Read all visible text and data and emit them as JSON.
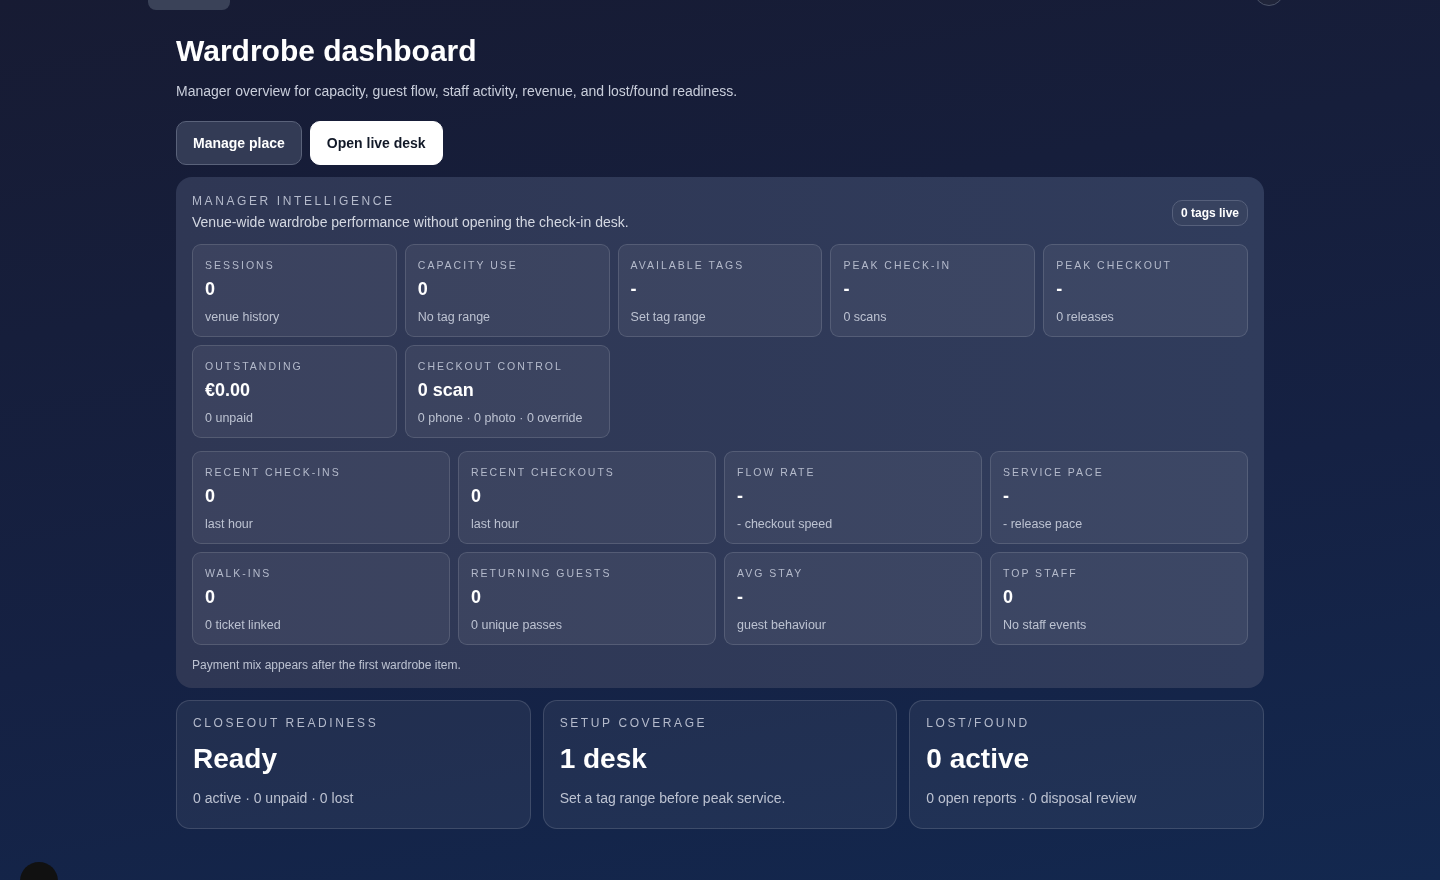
{
  "title": "Wardrobe dashboard",
  "subtitle": "Manager overview for capacity, guest flow, staff activity, revenue, and lost/found readiness.",
  "actions": [
    {
      "label": "Manage place",
      "kind": "secondary"
    },
    {
      "label": "Open live desk",
      "kind": "primary"
    }
  ],
  "intelligence": {
    "heading": "MANAGER INTELLIGENCE",
    "description": "Venue-wide wardrobe performance without opening the check-in desk.",
    "badge": "0 tags live",
    "groups": [
      {
        "kind": "compact",
        "cards": [
          {
            "label": "SESSIONS",
            "value": "0",
            "detail": "venue history"
          },
          {
            "label": "CAPACITY USE",
            "value": "0",
            "detail": "No tag range"
          },
          {
            "label": "AVAILABLE TAGS",
            "value": "-",
            "detail": "Set tag range"
          },
          {
            "label": "PEAK CHECK-IN",
            "value": "-",
            "detail": "0 scans"
          },
          {
            "label": "PEAK CHECKOUT",
            "value": "-",
            "detail": "0 releases"
          },
          {
            "label": "OUTSTANDING",
            "value": "€0.00",
            "detail": "0 unpaid"
          },
          {
            "label": "CHECKOUT CONTROL",
            "value": "0 scan",
            "detail": "0 phone · 0 photo · 0 override"
          }
        ]
      },
      {
        "kind": "wide",
        "cards": [
          {
            "label": "RECENT CHECK-INS",
            "value": "0",
            "detail": "last hour"
          },
          {
            "label": "RECENT CHECKOUTS",
            "value": "0",
            "detail": "last hour"
          },
          {
            "label": "FLOW RATE",
            "value": "-",
            "detail": "- checkout speed"
          },
          {
            "label": "SERVICE PACE",
            "value": "-",
            "detail": "- release pace"
          },
          {
            "label": "WALK-INS",
            "value": "0",
            "detail": "0 ticket linked"
          },
          {
            "label": "RETURNING GUESTS",
            "value": "0",
            "detail": "0 unique passes"
          },
          {
            "label": "AVG STAY",
            "value": "-",
            "detail": "guest behaviour"
          },
          {
            "label": "TOP STAFF",
            "value": "0",
            "detail": "No staff events"
          }
        ]
      }
    ],
    "note": "Payment mix appears after the first wardrobe item."
  },
  "summary": [
    {
      "label": "CLOSEOUT READINESS",
      "value": "Ready",
      "detail": "0 active · 0 unpaid · 0 lost"
    },
    {
      "label": "SETUP COVERAGE",
      "value": "1 desk",
      "detail": "Set a tag range before peak service."
    },
    {
      "label": "LOST/FOUND",
      "value": "0 active",
      "detail": "0 open reports · 0 disposal review"
    }
  ]
}
